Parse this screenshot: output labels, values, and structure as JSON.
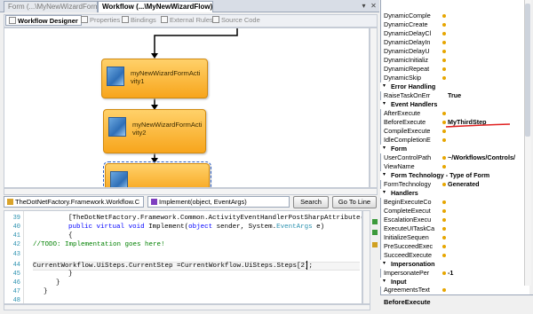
{
  "tabs": [
    {
      "label": "Form (...\\MyNewWizardForm)"
    },
    {
      "label": "Workflow (...\\MyNewWizardFlow)"
    }
  ],
  "tab_controls": {
    "dropdown": "▾",
    "close": "✕"
  },
  "designer_toolbar": {
    "items": [
      "Workflow Designer",
      "Properties",
      "Bindings",
      "External Rules",
      "Source Code"
    ]
  },
  "activities": [
    {
      "label": "myNewWizardFormActivity1"
    },
    {
      "label": "myNewWizardFormActivity2"
    }
  ],
  "navbar": {
    "type_combo": "TheDotNetFactory.Framework.Workflow.C",
    "member_combo": "Implement(object, EventArgs)",
    "search_label": "Search",
    "goto_label": "Go To Line"
  },
  "code": {
    "line_numbers": [
      "39",
      "40",
      "41",
      "42",
      "43",
      "44",
      "45",
      "46",
      "47",
      "48"
    ],
    "line1": "[TheDotNetFactory.Framework.Common.ActivityEventHandlerPostSharpAttribute()]",
    "line2_kw1": "public",
    "line2_kw2": "virtual",
    "line2_kw3": "void",
    "line2_rest": " Implement(",
    "line2_kw4": "object",
    "line2_rest2": " sender, System.",
    "line2_type": "EventArgs",
    "line2_rest3": " e)",
    "line3": "{",
    "line4": "//TODO: Implementation goes here!",
    "line6": "CurrentWorkflow.UiSteps.CurrentStep =CurrentWorkflow.UiSteps.Steps[2];",
    "line7": "}",
    "line8": "}",
    "line9": "}"
  },
  "properties": {
    "top_items": [
      "DynamicComple",
      "DynamicCreate",
      "DynamicDelayCl",
      "DynamicDelayIn",
      "DynamicDelayU",
      "DynamicInitializ",
      "DynamicRepeat",
      "DynamicSkip"
    ],
    "categories": [
      {
        "name": "Error Handling",
        "rows": [
          {
            "name": "RaiseTaskOnErr",
            "value": "True"
          }
        ]
      },
      {
        "name": "Event Handlers",
        "rows": [
          {
            "name": "AfterExecute",
            "value": ""
          },
          {
            "name": "BeforeExecute",
            "value": "MyThirdStep"
          },
          {
            "name": "CompileExecute",
            "value": ""
          },
          {
            "name": "IdleCompletionE",
            "value": ""
          }
        ]
      },
      {
        "name": "Form",
        "rows": [
          {
            "name": "UserControlPath",
            "value": "~/Workflows/Controls/"
          },
          {
            "name": "ViewName",
            "value": ""
          }
        ]
      },
      {
        "name": "Form Technology - Type of Form",
        "rows": [
          {
            "name": "FormTechnology",
            "value": "Generated"
          }
        ]
      },
      {
        "name": "Handlers",
        "rows": [
          {
            "name": "BeginExecuteCo",
            "value": ""
          },
          {
            "name": "CompleteExecut",
            "value": ""
          },
          {
            "name": "EscalationExecu",
            "value": ""
          },
          {
            "name": "ExecuteUITaskCa",
            "value": ""
          },
          {
            "name": "InitializeSequen",
            "value": ""
          },
          {
            "name": "PreSucceedExec",
            "value": ""
          },
          {
            "name": "SucceedExecute",
            "value": ""
          }
        ]
      },
      {
        "name": "Impersonation",
        "rows": [
          {
            "name": "ImpersonatePer",
            "value": "-1"
          }
        ]
      },
      {
        "name": "Input",
        "rows": [
          {
            "name": "AgreementsText",
            "value": ""
          }
        ]
      }
    ],
    "description_title": "BeforeExecute",
    "highlight_color": "#e02020"
  },
  "colors": {
    "activity_fill": "#f7a51c",
    "keyword": "#0000ff",
    "comment": "#008000",
    "type": "#2b91af"
  }
}
